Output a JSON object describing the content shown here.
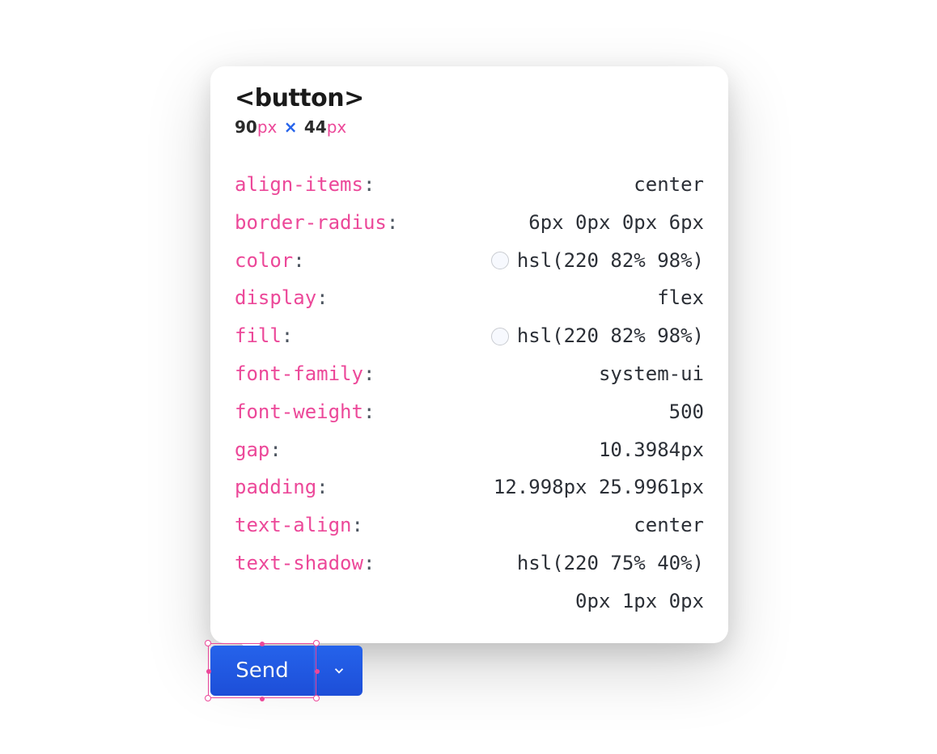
{
  "element": {
    "tag": "<button>",
    "width": "90",
    "height": "44",
    "unit": "px"
  },
  "properties": [
    {
      "name": "align-items",
      "value": "center",
      "swatch": false
    },
    {
      "name": "border-radius",
      "value": "6px 0px 0px 6px",
      "swatch": false
    },
    {
      "name": "color",
      "value": "hsl(220 82% 98%)",
      "swatch": true
    },
    {
      "name": "display",
      "value": "flex",
      "swatch": false
    },
    {
      "name": "fill",
      "value": "hsl(220 82% 98%)",
      "swatch": true
    },
    {
      "name": "font-family",
      "value": "system-ui",
      "swatch": false
    },
    {
      "name": "font-weight",
      "value": "500",
      "swatch": false
    },
    {
      "name": "gap",
      "value": "10.3984px",
      "swatch": false
    },
    {
      "name": "padding",
      "value": "12.998px 25.9961px",
      "swatch": false
    },
    {
      "name": "text-align",
      "value": "center",
      "swatch": false
    },
    {
      "name": "text-shadow",
      "value_lines": [
        "hsl(220 75% 40%)",
        "0px 1px 0px"
      ],
      "swatch": false
    }
  ],
  "button": {
    "label": "Send"
  }
}
